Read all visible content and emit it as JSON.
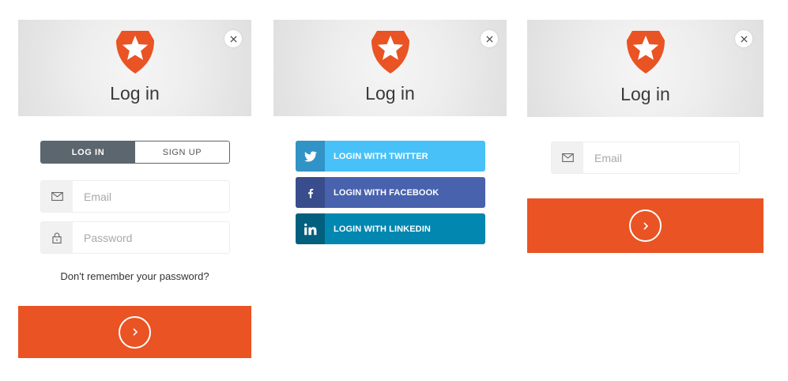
{
  "colors": {
    "accent": "#ea5323",
    "tab_active_bg": "#5c666f",
    "input_icon_bg": "#f1f1f1",
    "placeholder": "#a9a9a9",
    "white": "#ffffff"
  },
  "icons": {
    "logo": "auth0-shield-star-icon",
    "close": "close-icon",
    "email": "mail-icon",
    "password": "lock-icon",
    "submit": "chevron-right-icon"
  },
  "panels": {
    "login": {
      "header": {
        "title": "Log in"
      },
      "tabs": [
        {
          "label": "LOG IN",
          "active": true
        },
        {
          "label": "SIGN UP",
          "active": false
        }
      ],
      "email": {
        "placeholder": "Email"
      },
      "password": {
        "placeholder": "Password"
      },
      "forgot_link": "Don't remember your password?"
    },
    "social": {
      "header": {
        "title": "Log in"
      },
      "buttons": [
        {
          "label": "LOGIN WITH TWITTER",
          "icon": "twitter-icon",
          "color": "#48c1f8",
          "icon_bg": "#3293c6"
        },
        {
          "label": "LOGIN WITH FACEBOOK",
          "icon": "facebook-icon",
          "color": "#4862ae",
          "icon_bg": "#394d8c"
        },
        {
          "label": "LOGIN WITH LINKEDIN",
          "icon": "linkedin-icon",
          "color": "#0287b0",
          "icon_bg": "#025f7e"
        }
      ]
    },
    "passwordless": {
      "header": {
        "title": "Log in"
      },
      "email": {
        "placeholder": "Email"
      }
    }
  }
}
